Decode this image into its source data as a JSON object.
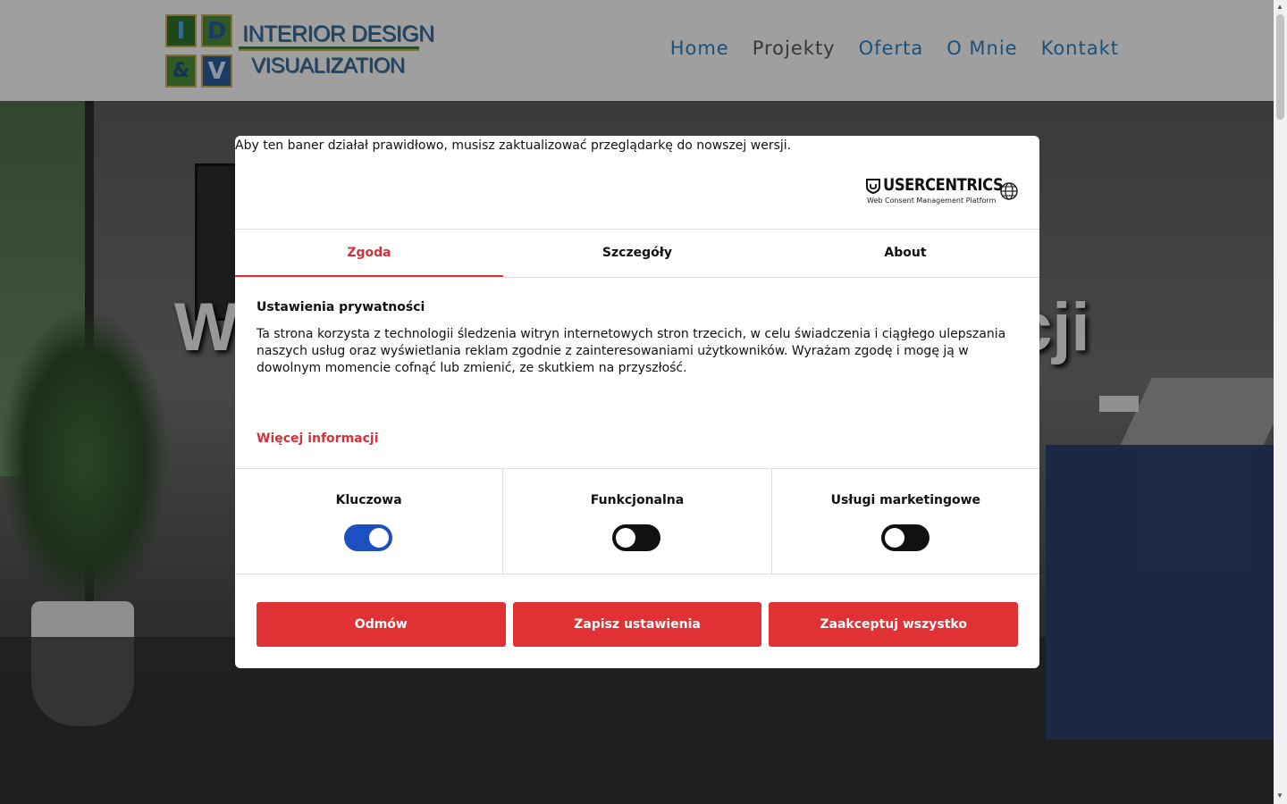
{
  "header": {
    "logo": {
      "tiles": [
        "I",
        "D",
        "&",
        "V"
      ],
      "line1": "INTERIOR DESIGN",
      "line2": "VISUALIZATION"
    },
    "nav": [
      {
        "label": "Home",
        "active": false
      },
      {
        "label": "Projekty",
        "active": true
      },
      {
        "label": "Oferta",
        "active": false
      },
      {
        "label": "O Mnie",
        "active": false
      },
      {
        "label": "Kontakt",
        "active": false
      }
    ],
    "nav_color": "#2e7bb8"
  },
  "hero": {
    "title_left_visible": "W",
    "title_right_visible": "cji"
  },
  "consent": {
    "warning": "Aby ten baner działał prawidłowo, musisz zaktualizować przeglądarkę do nowszej wersji.",
    "brand_name": "USERCENTRICS",
    "brand_sub": "Web Consent Management Platform",
    "language_icon": "globe-icon",
    "tabs": [
      {
        "label": "Zgoda",
        "active": true
      },
      {
        "label": "Szczegóły",
        "active": false
      },
      {
        "label": "About",
        "active": false
      }
    ],
    "section_title": "Ustawienia prywatności",
    "description": "Ta strona korzysta z technologii śledzenia witryn internetowych stron trzecich, w celu świadczenia i ciągłego ulepszania naszych usług oraz wyświetlania reklam zgodnie z zainteresowaniami użytkowników. Wyrażam zgodę i mogę ją w dowolnym momencie cofnąć lub zmienić, ze skutkiem na przyszłość.",
    "more_info": "Więcej informacji",
    "categories": [
      {
        "label": "Kluczowa",
        "enabled": true
      },
      {
        "label": "Funkcjonalna",
        "enabled": false
      },
      {
        "label": "Usługi marketingowe",
        "enabled": false
      }
    ],
    "buttons": {
      "deny": "Odmów",
      "save": "Zapisz ustawienia",
      "accept_all": "Zaakceptuj wszystko"
    },
    "accent_color": "#d3323a",
    "toggle_on_color": "#1e4fc0"
  }
}
